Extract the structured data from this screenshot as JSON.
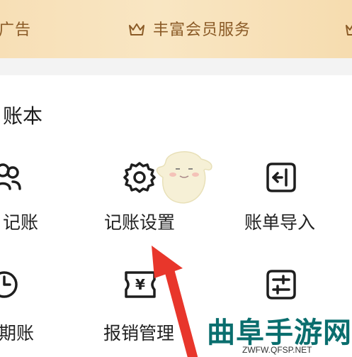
{
  "banner": {
    "left_label": "广告",
    "member_label": "丰富会员服务",
    "crown_icon": "crown-icon"
  },
  "section": {
    "title": "账本"
  },
  "grid": {
    "row1": [
      {
        "label": "记账",
        "icon": "users-icon"
      },
      {
        "label": "记账设置",
        "icon": "gear-icon"
      },
      {
        "label": "账单导入",
        "icon": "import-icon"
      }
    ],
    "row2": [
      {
        "label": "期账",
        "icon": "clock-icon"
      },
      {
        "label": "报销管理",
        "icon": "yen-ticket-icon"
      },
      {
        "label": "",
        "icon": "sliders-icon"
      }
    ]
  },
  "watermark": {
    "title": "曲阜手游网",
    "url": "ZWFW.QFSP.NET"
  },
  "colors": {
    "banner_text": "#8a5a26",
    "arrow": "#e8362b",
    "watermark": "#0a6e6e"
  }
}
